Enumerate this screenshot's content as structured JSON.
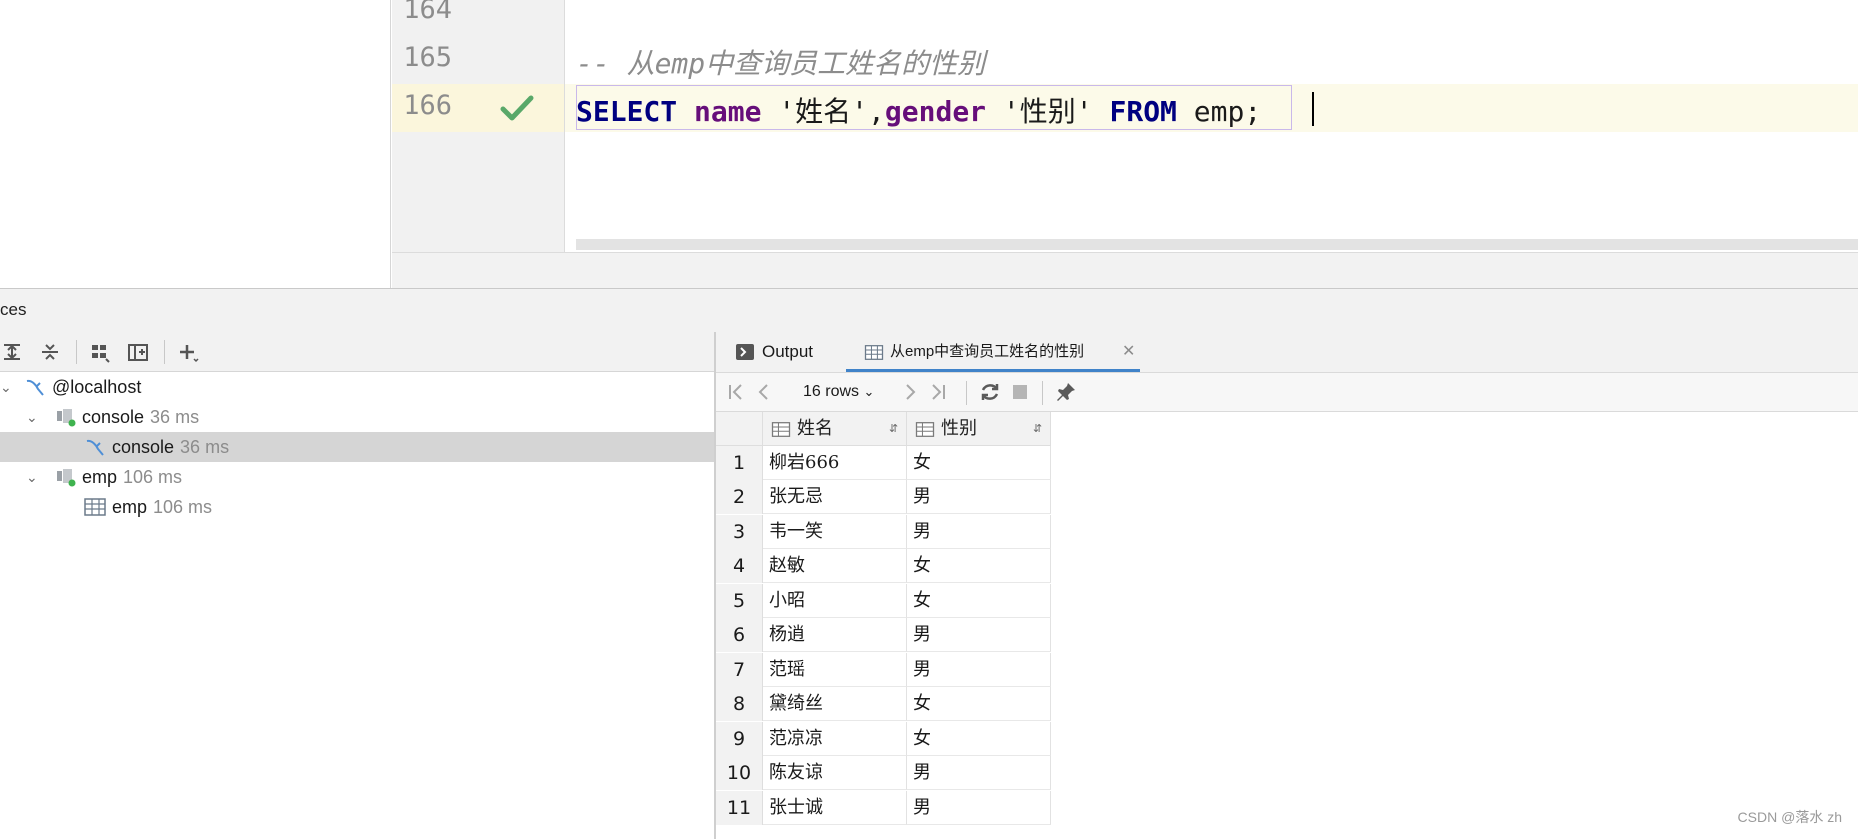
{
  "editor": {
    "lines": [
      {
        "num": "164",
        "text": ""
      },
      {
        "num": "165",
        "text": "-- 从emp中查询员工姓名的性别"
      },
      {
        "num": "166",
        "text": "SELECT name '姓名',gender '性别' FROM emp;"
      }
    ],
    "sql_tokens": {
      "select": "SELECT",
      "name": "name",
      "alias1": "'姓名'",
      "comma": ",",
      "gender": "gender",
      "alias2": "'性别'",
      "from": "FROM",
      "table": "emp",
      "semi": ";"
    },
    "check_icon": "checkmark-icon",
    "colors": {
      "keyword": "#000080",
      "column": "#660e7a",
      "comment": "#8c8c8c",
      "check": "#59a869"
    }
  },
  "tool_window": {
    "title": "ces"
  },
  "tree": [
    {
      "label": "@localhost",
      "meta": ""
    },
    {
      "label": "console",
      "meta": "36 ms"
    },
    {
      "label": "console",
      "meta": "36 ms"
    },
    {
      "label": "emp",
      "meta": "106 ms"
    },
    {
      "label": "emp",
      "meta": "106 ms"
    }
  ],
  "tabs": [
    {
      "label": "Output"
    },
    {
      "label": "从emp中查询员工姓名的性别"
    }
  ],
  "result_toolbar": {
    "rows_label": "16 rows"
  },
  "grid": {
    "columns": [
      "姓名",
      "性别"
    ],
    "rows": [
      {
        "n": "1",
        "name": "柳岩666",
        "gender": "女"
      },
      {
        "n": "2",
        "name": "张无忌",
        "gender": "男"
      },
      {
        "n": "3",
        "name": "韦一笑",
        "gender": "男"
      },
      {
        "n": "4",
        "name": "赵敏",
        "gender": "女"
      },
      {
        "n": "5",
        "name": "小昭",
        "gender": "女"
      },
      {
        "n": "6",
        "name": "杨逍",
        "gender": "男"
      },
      {
        "n": "7",
        "name": "范瑶",
        "gender": "男"
      },
      {
        "n": "8",
        "name": "黛绮丝",
        "gender": "女"
      },
      {
        "n": "9",
        "name": "范凉凉",
        "gender": "女"
      },
      {
        "n": "10",
        "name": "陈友谅",
        "gender": "男"
      },
      {
        "n": "11",
        "name": "张士诚",
        "gender": "男"
      }
    ]
  },
  "watermark": "CSDN @落水 zh"
}
